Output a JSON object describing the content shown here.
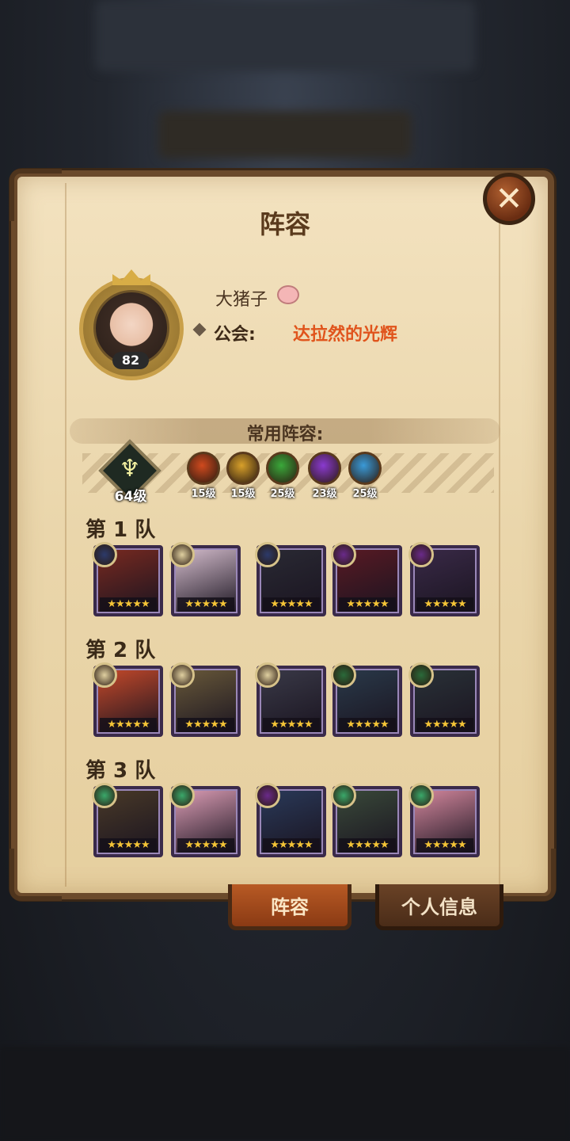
{
  "title": "阵容",
  "close_icon": "close-icon",
  "player": {
    "name": "大猪子",
    "avatar_level": "82",
    "guild_label": "公会:",
    "guild_name": "达拉然的光辉"
  },
  "lineup": {
    "section_title": "常用阵容:",
    "tree_level": "64级",
    "factions": [
      {
        "name": "lightbearer-icon",
        "level": "15级",
        "color": "#d04a1e"
      },
      {
        "name": "mauler-icon",
        "level": "15级",
        "color": "#d8a02a"
      },
      {
        "name": "wilder-icon",
        "level": "25级",
        "color": "#3aa83a"
      },
      {
        "name": "graveborn-icon",
        "level": "23级",
        "color": "#8a3ad0"
      },
      {
        "name": "celestial-icon",
        "level": "25级",
        "color": "#3a9ad8"
      }
    ]
  },
  "teams": [
    {
      "label": "第 1 队",
      "heroes": [
        {
          "emblem": "#2c3a6a",
          "bg": "#7a2a20",
          "stars": "★★★★★"
        },
        {
          "emblem": "#e0d0a0",
          "bg": "#d8c0d0",
          "stars": "★★★★★"
        },
        {
          "emblem": "#2c3a6a",
          "bg": "#2a2a34",
          "stars": "★★★★★"
        },
        {
          "emblem": "#6a2a8a",
          "bg": "#5a1a24",
          "stars": "★★★★★"
        },
        {
          "emblem": "#6a2a8a",
          "bg": "#3a2a48",
          "stars": "★★★★★"
        }
      ]
    },
    {
      "label": "第 2 队",
      "heroes": [
        {
          "emblem": "#e0d0a0",
          "bg": "#c84a2a",
          "stars": "★★★★★"
        },
        {
          "emblem": "#e0d0a0",
          "bg": "#6a5a3a",
          "stars": "★★★★★"
        },
        {
          "emblem": "#e0d0a0",
          "bg": "#3a3a48",
          "stars": "★★★★★"
        },
        {
          "emblem": "#2a6a3a",
          "bg": "#2a3a4a",
          "stars": "★★★★★"
        },
        {
          "emblem": "#2a6a3a",
          "bg": "#2a3238",
          "stars": "★★★★★"
        }
      ]
    },
    {
      "label": "第 3 队",
      "heroes": [
        {
          "emblem": "#3aa86a",
          "bg": "#4a3a28",
          "stars": "★★★★★"
        },
        {
          "emblem": "#3aa86a",
          "bg": "#e0a0b8",
          "stars": "★★★★★"
        },
        {
          "emblem": "#6a2a8a",
          "bg": "#2a3a5a",
          "stars": "★★★★★"
        },
        {
          "emblem": "#3aa86a",
          "bg": "#3a4a3a",
          "stars": "★★★★★"
        },
        {
          "emblem": "#3aa86a",
          "bg": "#d88aa0",
          "stars": "★★★★★"
        }
      ]
    }
  ],
  "tabs": {
    "lineup": "阵容",
    "profile": "个人信息"
  }
}
